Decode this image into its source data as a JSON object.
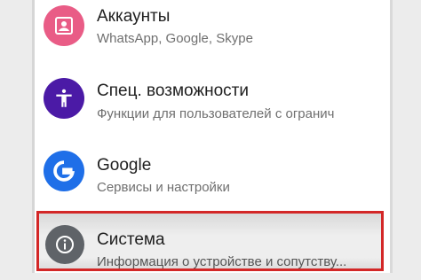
{
  "items": [
    {
      "icon": "account-box-icon",
      "title": "Аккаунты",
      "subtitle": "WhatsApp, Google, Skype",
      "color": "#e95c86"
    },
    {
      "icon": "accessibility-icon",
      "title": "Спец. возможности",
      "subtitle": "Функции для пользователей с огранич",
      "color": "#4b1aa6"
    },
    {
      "icon": "google-icon",
      "title": "Google",
      "subtitle": "Сервисы и настройки",
      "color": "#1f6fe8"
    },
    {
      "icon": "info-icon",
      "title": "Система",
      "subtitle": "Информация о устройстве и сопутству...",
      "color": "#5f6368",
      "highlighted": true
    }
  ],
  "highlight_color": "#d32727"
}
